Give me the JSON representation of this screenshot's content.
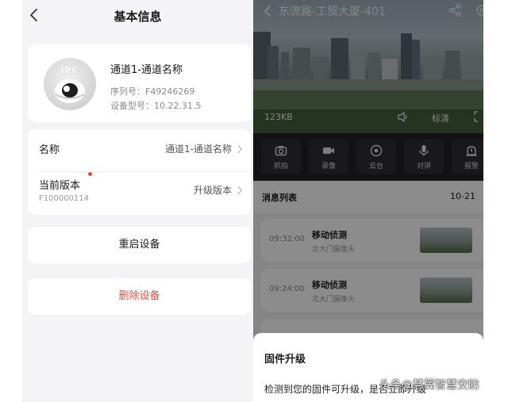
{
  "left": {
    "title": "基本信息",
    "device": {
      "badge": "IPC",
      "name": "通道1-通道名称",
      "serial": "序列号：F49246269",
      "model": "设备型号：10.22.31.5"
    },
    "name_row": {
      "label": "名称",
      "value": "通道1-通道名称"
    },
    "version_row": {
      "label": "当前版本",
      "version": "F100000114",
      "action": "升级版本"
    },
    "restart_label": "重启设备",
    "delete_label": "删除设备"
  },
  "right": {
    "title": "东流路-工贸大厦-401",
    "speed": "123KB",
    "quality": "标清",
    "tools": [
      "抓拍",
      "录像",
      "云台",
      "对讲",
      "报警"
    ],
    "messages": {
      "title": "消息列表",
      "date": "10-21",
      "items": [
        {
          "time": "09:32:00",
          "event": "移动侦测",
          "camera": "北大门摄像头"
        },
        {
          "time": "09:24:00",
          "event": "移动侦测",
          "camera": "北大门摄像头"
        }
      ]
    },
    "sheet": {
      "title": "固件升级",
      "body": "检测到您的固件可升级，是否立即升级"
    }
  },
  "watermark": "头条@慧翼智慧安防",
  "colors": {
    "danger": "#e64a3c",
    "badge_dot": "#e64a2e",
    "toolbar_bg": "#222226"
  }
}
